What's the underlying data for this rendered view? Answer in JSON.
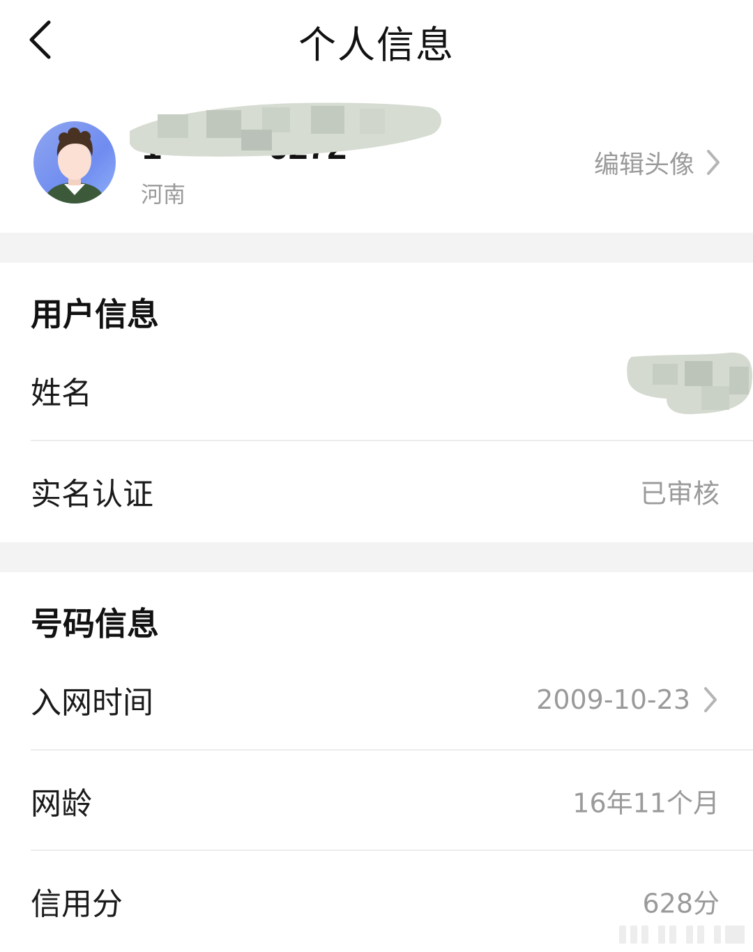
{
  "header": {
    "title": "个人信息"
  },
  "profile": {
    "province": "河南",
    "edit_avatar_label": "编辑头像"
  },
  "user_info": {
    "title": "用户信息",
    "rows": [
      {
        "label": "姓名",
        "value": ""
      },
      {
        "label": "实名认证",
        "value": "已审核"
      }
    ]
  },
  "number_info": {
    "title": "号码信息",
    "rows": [
      {
        "label": "入网时间",
        "value": "2009-10-23"
      },
      {
        "label": "网龄",
        "value": "16年11个月"
      },
      {
        "label": "信用分",
        "value": "628分"
      }
    ]
  },
  "icons": {
    "back": "chevron-left-icon",
    "forward": "chevron-right-icon"
  },
  "colors": {
    "secondary_text": "#9a9a9a",
    "separator": "#f3f3f3"
  }
}
